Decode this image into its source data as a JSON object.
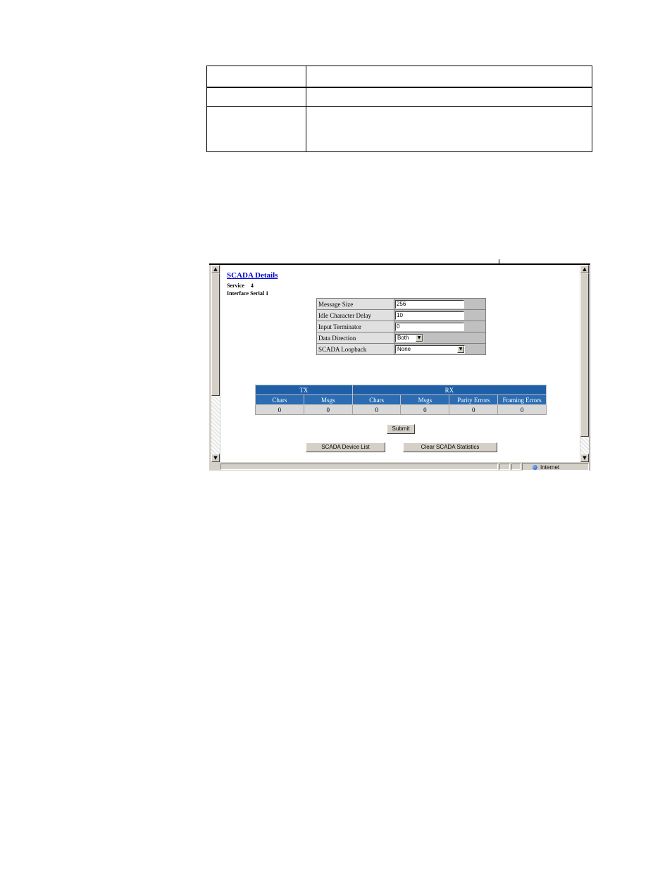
{
  "doc_table": {
    "rows": [
      [
        "",
        ""
      ],
      [
        "",
        ""
      ],
      [
        "",
        ""
      ]
    ]
  },
  "page": {
    "title": "SCADA Details",
    "service_label": "Service",
    "service_value": "4",
    "interface_label": "Interface",
    "interface_value": "Serial 1"
  },
  "settings": {
    "message_size": {
      "label": "Message Size",
      "value": "256"
    },
    "idle_char_delay": {
      "label": "Idle Character Delay",
      "value": "10"
    },
    "input_terminator": {
      "label": "Input Terminator",
      "value": "0"
    },
    "data_direction": {
      "label": "Data Direction",
      "value": "Both"
    },
    "scada_loopback": {
      "label": "SCADA Loopback",
      "value": "None"
    }
  },
  "stats": {
    "groups": [
      "TX",
      "RX"
    ],
    "columns": [
      "Chars",
      "Msgs",
      "Chars",
      "Msgs",
      "Parity Errors",
      "Framing Errors"
    ],
    "values": [
      "0",
      "0",
      "0",
      "0",
      "0",
      "0"
    ]
  },
  "buttons": {
    "submit": "Submit",
    "device_list": "SCADA Device List",
    "clear_stats": "Clear SCADA Statistics"
  },
  "status_bar": {
    "zone": "Internet"
  },
  "icons": {
    "scroll_up": "▲",
    "scroll_down": "▼",
    "dropdown": "▼"
  },
  "colors": {
    "link": "#0000cc",
    "table_header": "#1f5fa8"
  }
}
